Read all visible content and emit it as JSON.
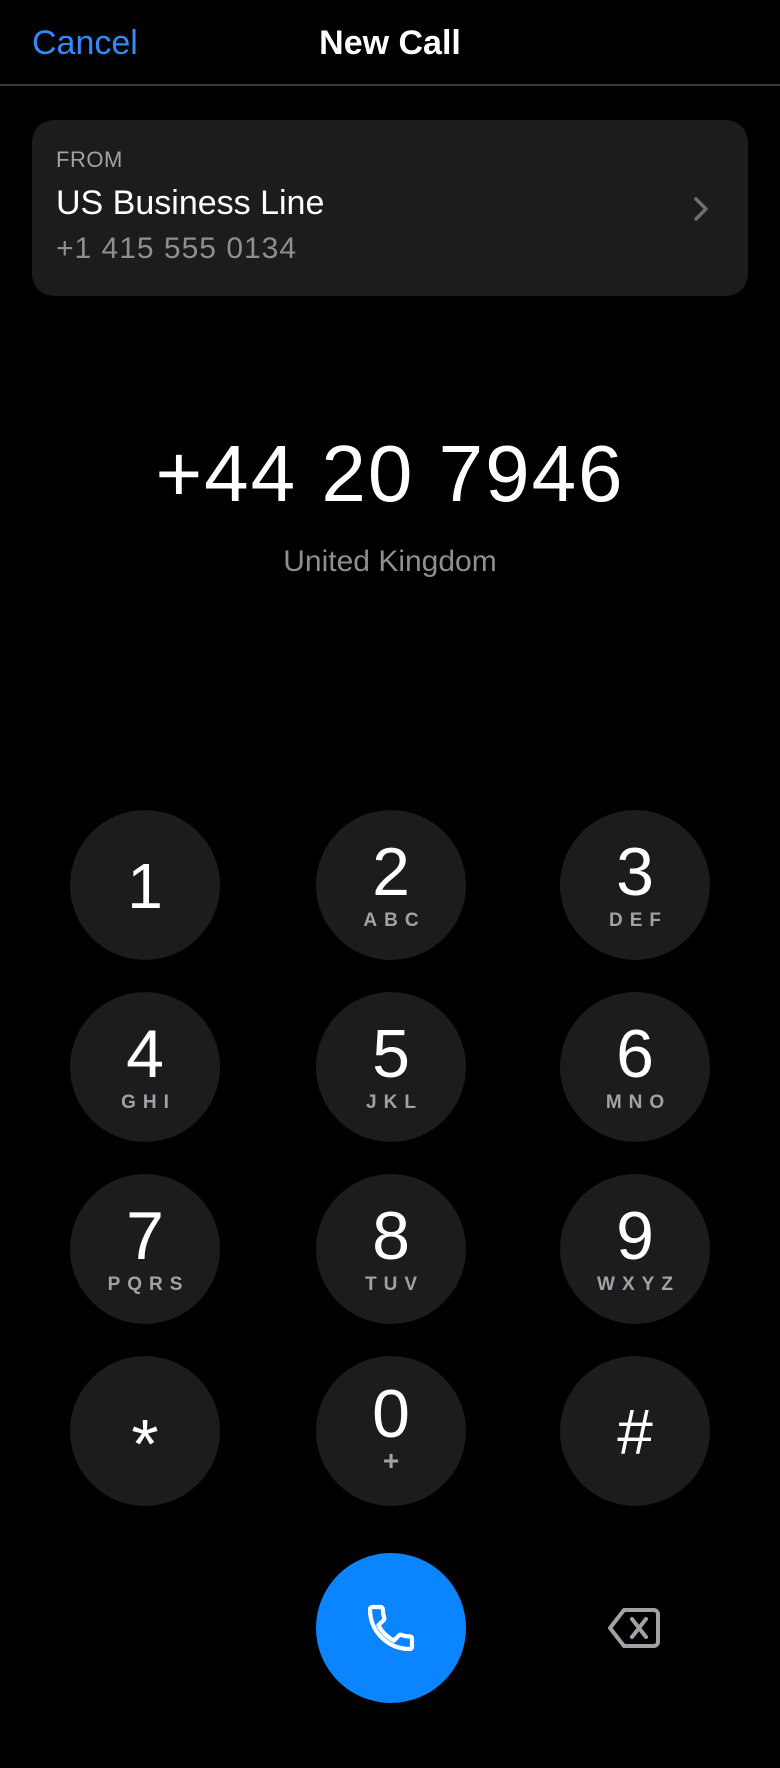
{
  "nav": {
    "cancel_label": "Cancel",
    "title": "New Call"
  },
  "from": {
    "label": "FROM",
    "line_name": "US Business Line",
    "line_number": "+1 415 555 0134"
  },
  "dialed": {
    "number": "+44 20 7946",
    "country": "United Kingdom"
  },
  "keypad": [
    {
      "digit": "1",
      "letters": ""
    },
    {
      "digit": "2",
      "letters": "ABC"
    },
    {
      "digit": "3",
      "letters": "DEF"
    },
    {
      "digit": "4",
      "letters": "GHI"
    },
    {
      "digit": "5",
      "letters": "JKL"
    },
    {
      "digit": "6",
      "letters": "MNO"
    },
    {
      "digit": "7",
      "letters": "PQRS"
    },
    {
      "digit": "8",
      "letters": "TUV"
    },
    {
      "digit": "9",
      "letters": "WXYZ"
    },
    {
      "digit": "*",
      "letters": ""
    },
    {
      "digit": "0",
      "letters": "+"
    },
    {
      "digit": "#",
      "letters": ""
    }
  ],
  "icons": {
    "chevron": "chevron-right-icon",
    "call": "phone-icon",
    "backspace": "backspace-icon"
  },
  "colors": {
    "accent": "#2f8cff",
    "call_button": "#0a84ff",
    "key_background": "#1c1c1e",
    "secondary_text": "#8e8e93"
  }
}
